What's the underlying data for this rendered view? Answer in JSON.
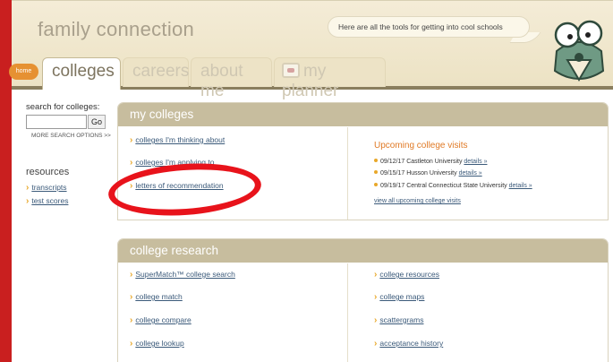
{
  "header": {
    "brand": "family connection",
    "tagline": "Here are all the tools for getting into cool schools"
  },
  "nav": {
    "home": "home",
    "tabs": [
      {
        "label": "colleges",
        "active": true
      },
      {
        "label": "careers",
        "active": false
      },
      {
        "label": "about me",
        "active": false
      },
      {
        "label": "my planner",
        "active": false
      }
    ]
  },
  "sidebar": {
    "search_label": "search for colleges:",
    "search_value": "",
    "go_label": "Go",
    "more_options": "MORE SEARCH OPTIONS >>",
    "resources_title": "resources",
    "resources": [
      "transcripts",
      "test scores"
    ]
  },
  "my_colleges": {
    "title": "my colleges",
    "links": [
      "colleges I'm thinking about",
      "colleges I'm applying to",
      "letters of recommendation"
    ],
    "visits_title": "Upcoming college visits",
    "visits": [
      {
        "date": "09/12/17",
        "school": "Castleton University",
        "details": "details »"
      },
      {
        "date": "09/15/17",
        "school": "Husson University",
        "details": "details »"
      },
      {
        "date": "09/19/17",
        "school": "Central Connecticut State University",
        "details": "details »"
      }
    ],
    "view_all": "view all upcoming college visits"
  },
  "college_research": {
    "title": "college research",
    "left_links": [
      "SuperMatch™ college search",
      "college match",
      "college compare",
      "college lookup"
    ],
    "right_links": [
      "college resources",
      "college maps",
      "scattergrams",
      "acceptance history"
    ]
  },
  "colors": {
    "accent_red": "#c91f1f",
    "panel_header": "#c7bd9e",
    "link": "#3b5a7a",
    "orange": "#e07a26",
    "annotation": "#e8131b"
  }
}
